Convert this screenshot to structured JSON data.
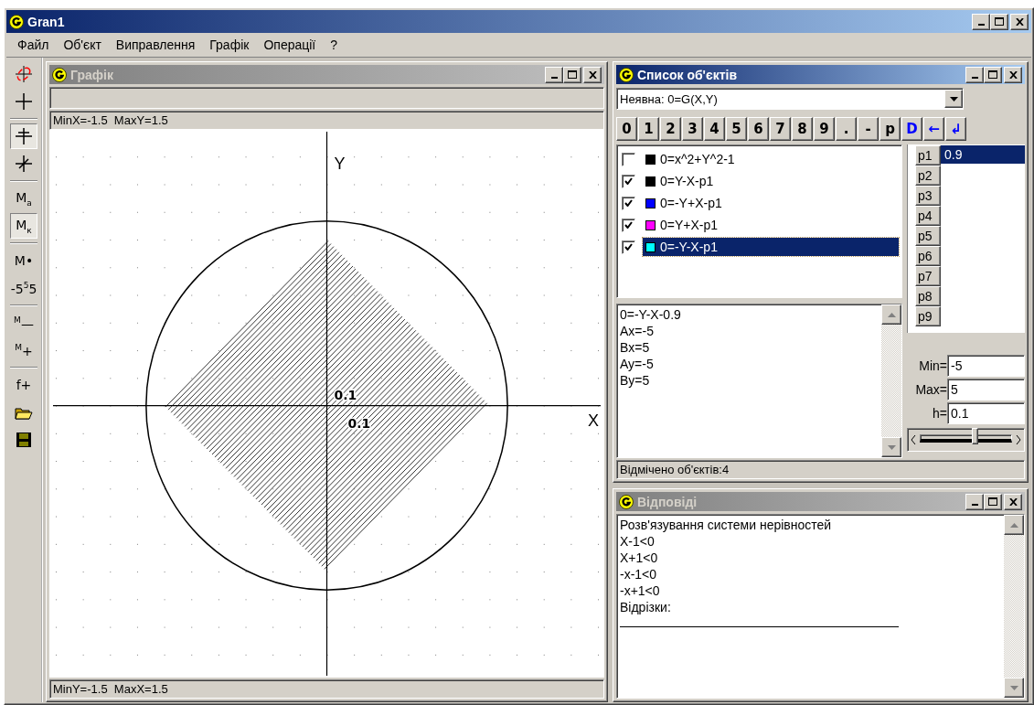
{
  "window": {
    "title": "Gran1"
  },
  "menu": [
    "Файл",
    "Об'єкт",
    "Виправлення",
    "Графік",
    "Операції",
    "?"
  ],
  "toolbar": [
    {
      "kind": "axes-color",
      "pressed": false
    },
    {
      "kind": "cross",
      "pressed": false
    },
    {
      "kind": "separator"
    },
    {
      "kind": "cross-box",
      "pressed": true
    },
    {
      "kind": "cross-diag",
      "pressed": false
    },
    {
      "kind": "separator"
    },
    {
      "kind": "label",
      "label": "M$_{a}$",
      "pressed": false
    },
    {
      "kind": "label",
      "label": "M$_{к}$",
      "pressed": true
    },
    {
      "kind": "separator"
    },
    {
      "kind": "label",
      "label": "M•",
      "pressed": false
    },
    {
      "kind": "label",
      "label": "-5$^{5}$5",
      "pressed": false
    },
    {
      "kind": "separator"
    },
    {
      "kind": "label",
      "label": "$^{M}$—",
      "pressed": false
    },
    {
      "kind": "label",
      "label": "$^{M}$+",
      "pressed": false
    },
    {
      "kind": "separator"
    },
    {
      "kind": "label",
      "label": "f+",
      "pressed": false
    },
    {
      "kind": "open",
      "pressed": false
    },
    {
      "kind": "save",
      "pressed": false
    }
  ],
  "graph_window": {
    "title": "Графік",
    "active": false,
    "top_status": "MinX=-1.5  MaxY=1.5",
    "bottom_status": "MinY=-1.5  MaxX=1.5",
    "axis_x": "X",
    "axis_y": "Y",
    "tick_labels": [
      "0.1",
      "0.1"
    ]
  },
  "objects_window": {
    "title": "Список об'єктів",
    "active": true,
    "type_select": "Неявна: 0=G(X,Y)",
    "keys": [
      {
        "label": "0",
        "color": "#000000"
      },
      {
        "label": "1",
        "color": "#000000"
      },
      {
        "label": "2",
        "color": "#000000"
      },
      {
        "label": "3",
        "color": "#000000"
      },
      {
        "label": "4",
        "color": "#000000"
      },
      {
        "label": "5",
        "color": "#000000"
      },
      {
        "label": "6",
        "color": "#000000"
      },
      {
        "label": "7",
        "color": "#000000"
      },
      {
        "label": "8",
        "color": "#000000"
      },
      {
        "label": "9",
        "color": "#000000"
      },
      {
        "label": ".",
        "color": "#000000"
      },
      {
        "label": "-",
        "color": "#000000"
      },
      {
        "label": "p",
        "color": "#000000"
      },
      {
        "label": "D",
        "color": "#0000ff"
      },
      {
        "label": "←",
        "color": "#0000ff"
      },
      {
        "label": "↲",
        "color": "#0000ff"
      }
    ],
    "objects": [
      {
        "formula": "0=x^2+Y^2-1",
        "checked": false,
        "color": "#000000",
        "selected": false
      },
      {
        "formula": "0=Y-X-p1",
        "checked": true,
        "color": "#000000",
        "selected": false
      },
      {
        "formula": "0=-Y+X-p1",
        "checked": true,
        "color": "#0000ff",
        "selected": false
      },
      {
        "formula": "0=Y+X-p1",
        "checked": true,
        "color": "#ff00ff",
        "selected": false
      },
      {
        "formula": "0=-Y-X-p1",
        "checked": true,
        "color": "#00ffff",
        "selected": true
      }
    ],
    "info": [
      "0=-Y-X-0.9",
      "Ax=-5",
      "Bx=5",
      "Ay=-5",
      "By=5"
    ],
    "params": [
      {
        "name": "p1",
        "value": "0.9",
        "selected": true
      },
      {
        "name": "p2",
        "selected": false
      },
      {
        "name": "p3",
        "selected": false
      },
      {
        "name": "p4",
        "selected": false
      },
      {
        "name": "p5",
        "selected": false
      },
      {
        "name": "p6",
        "selected": false
      },
      {
        "name": "p7",
        "selected": false
      },
      {
        "name": "p8",
        "selected": false
      },
      {
        "name": "p9",
        "selected": false
      }
    ],
    "range": [
      {
        "label": "Min=",
        "value": "-5"
      },
      {
        "label": "Max=",
        "value": "5"
      },
      {
        "label": "h=",
        "value": "0.1"
      }
    ],
    "slider": {
      "level": 0.6
    },
    "status": "Відмічено об'єктів:4"
  },
  "answers_window": {
    "title": "Відповіді",
    "active": false,
    "lines": [
      "Розв'язування системи нерівностей",
      "X-1<0",
      "X+1<0",
      "-x-1<0",
      "-x+1<0",
      "Відрізки:"
    ]
  }
}
